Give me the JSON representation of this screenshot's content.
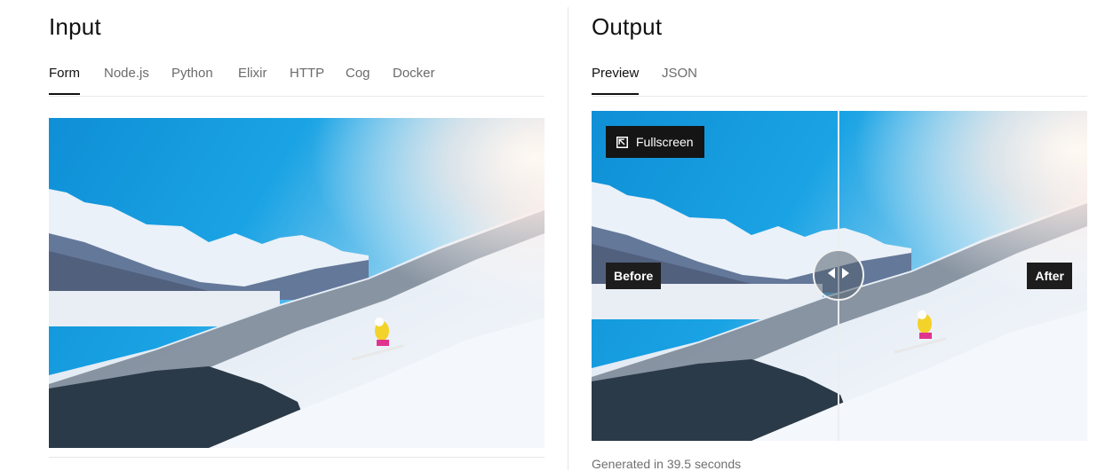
{
  "input": {
    "heading": "Input",
    "tabs": [
      {
        "label": "Form",
        "active": true
      },
      {
        "label": "Node.js"
      },
      {
        "label": "Python"
      },
      {
        "label": "Elixir"
      },
      {
        "label": "HTTP"
      },
      {
        "label": "Cog"
      },
      {
        "label": "Docker"
      }
    ],
    "image_icon": "ski-photo"
  },
  "output": {
    "heading": "Output",
    "tabs": [
      {
        "label": "Preview",
        "active": true
      },
      {
        "label": "JSON"
      }
    ],
    "fullscreen_label": "Fullscreen",
    "fullscreen_icon": "fullscreen-icon",
    "before_label": "Before",
    "after_label": "After",
    "handle_icon": "compare-arrows-icon",
    "generated_text": "Generated in 39.5 seconds",
    "compare_position_fraction": 0.5
  }
}
